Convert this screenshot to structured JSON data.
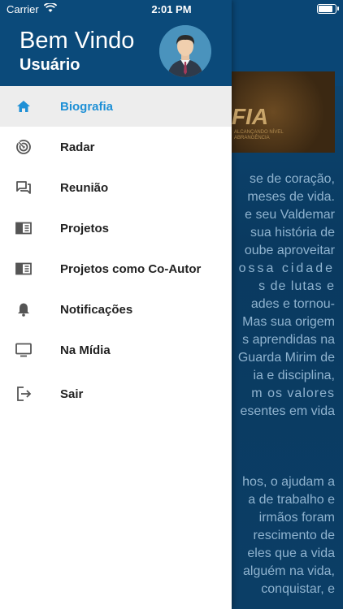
{
  "status_bar": {
    "carrier": "Carrier",
    "time": "2:01 PM"
  },
  "drawer": {
    "welcome": "Bem Vindo",
    "username": "Usuário",
    "items": [
      {
        "label": "Biografia",
        "icon": "home-icon",
        "active": true
      },
      {
        "label": "Radar",
        "icon": "radar-icon"
      },
      {
        "label": "Reunião",
        "icon": "chat-icon"
      },
      {
        "label": "Projetos",
        "icon": "book-icon"
      },
      {
        "label": "Projetos como Co-Autor",
        "icon": "book-icon"
      },
      {
        "label": "Notificações",
        "icon": "bell-icon"
      },
      {
        "label": "Na Mídia",
        "icon": "tv-icon"
      },
      {
        "label": "Sair",
        "icon": "exit-icon"
      }
    ]
  },
  "background": {
    "banner_text": "FIA",
    "banner_sub": [
      "ALCANÇANDO NÍVEL",
      "ABRANGÊNCIA"
    ],
    "paragraph1": [
      "se de coração,",
      "meses de vida.",
      "e seu Valdemar",
      "sua história de",
      "oube aproveitar",
      "ossa cidade",
      "s de lutas e",
      "ades e tornou-",
      "Mas sua origem",
      "s aprendidas na",
      "Guarda Mirim de",
      "ia e disciplina,",
      "m os valores",
      "esentes em vida"
    ],
    "paragraph2": [
      "hos, o ajudam a",
      "a de trabalho e",
      "irmãos foram",
      "rescimento de",
      "eles que a vida",
      "alguém na vida,",
      "conquistar, e"
    ]
  },
  "colors": {
    "header": "#0b4a7a",
    "accent": "#1e90d6",
    "active_bg": "#ededed"
  }
}
